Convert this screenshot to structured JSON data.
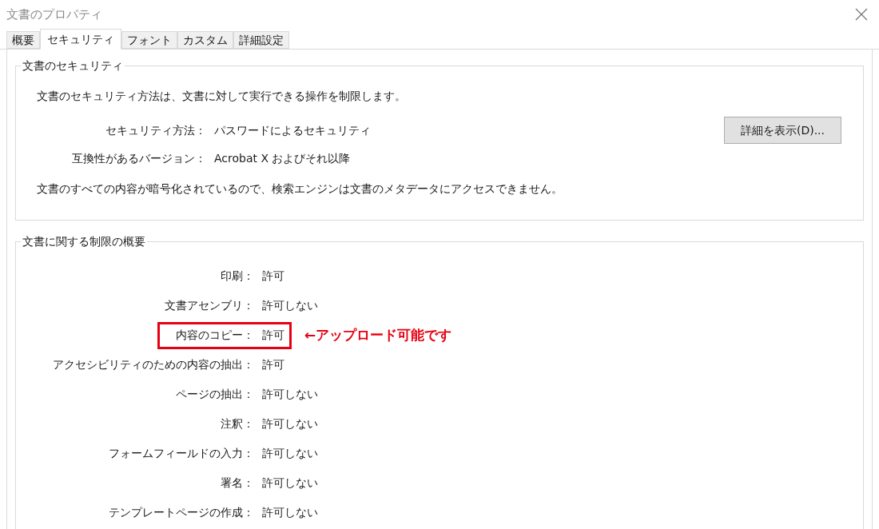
{
  "window": {
    "title": "文書のプロパティ"
  },
  "tabs": [
    {
      "label": "概要",
      "selected": false
    },
    {
      "label": "セキュリティ",
      "selected": true
    },
    {
      "label": "フォント",
      "selected": false
    },
    {
      "label": "カスタム",
      "selected": false
    },
    {
      "label": "詳細設定",
      "selected": false
    }
  ],
  "security": {
    "title": "文書のセキュリティ",
    "description": "文書のセキュリティ方法は、文書に対して実行できる操作を制限します。",
    "method_label": "セキュリティ方法：",
    "method_value": "パスワードによるセキュリティ",
    "details_button": "詳細を表示(D)...",
    "compat_label": "互換性があるバージョン：",
    "compat_value": "Acrobat X およびそれ以降",
    "note": "文書のすべての内容が暗号化されているので、検索エンジンは文書のメタデータにアクセスできません。"
  },
  "restrictions": {
    "title": "文書に関する制限の概要",
    "rows": [
      {
        "label": "印刷：",
        "value": "許可",
        "highlighted": false
      },
      {
        "label": "文書アセンブリ：",
        "value": "許可しない",
        "highlighted": false
      },
      {
        "label": "内容のコピー：",
        "value": "許可",
        "highlighted": true,
        "annotation": "←アップロード可能です"
      },
      {
        "label": "アクセシビリティのための内容の抽出：",
        "value": "許可",
        "highlighted": false
      },
      {
        "label": "ページの抽出：",
        "value": "許可しない",
        "highlighted": false
      },
      {
        "label": "注釈：",
        "value": "許可しない",
        "highlighted": false
      },
      {
        "label": "フォームフィールドの入力：",
        "value": "許可しない",
        "highlighted": false
      },
      {
        "label": "署名：",
        "value": "許可しない",
        "highlighted": false
      },
      {
        "label": "テンプレートページの作成：",
        "value": "許可しない",
        "highlighted": false
      }
    ]
  }
}
